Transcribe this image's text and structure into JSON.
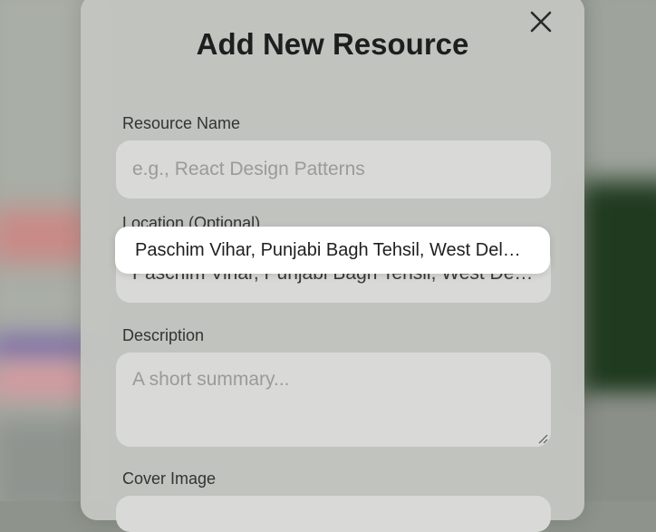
{
  "modal": {
    "title": "Add New Resource",
    "close_icon": "close-icon"
  },
  "fields": {
    "name": {
      "label": "Resource Name",
      "placeholder": "e.g., React Design Patterns",
      "value": ""
    },
    "location": {
      "label": "Location (Optional)",
      "value": "Paschim Vihar, Punjabi Bagh Tehsil, West Delhi, Delhi"
    },
    "description": {
      "label": "Description",
      "placeholder": "A short summary...",
      "value": ""
    },
    "cover": {
      "label": "Cover Image"
    }
  },
  "autocomplete": {
    "suggestions": [
      "Paschim Vihar, Punjabi Bagh Tehsil, West Delhi, Delhi"
    ]
  }
}
